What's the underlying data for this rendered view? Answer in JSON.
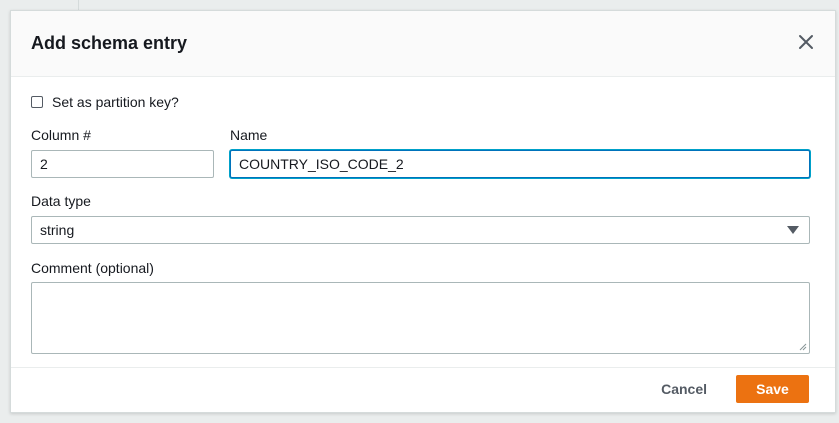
{
  "modal": {
    "title": "Add schema entry"
  },
  "form": {
    "partition_key_label": "Set as partition key?",
    "partition_key_checked": false,
    "column_label": "Column #",
    "column_value": "2",
    "name_label": "Name",
    "name_value": "COUNTRY_ISO_CODE_2",
    "data_type_label": "Data type",
    "data_type_value": "string",
    "comment_label": "Comment (optional)",
    "comment_value": ""
  },
  "footer": {
    "cancel_label": "Cancel",
    "save_label": "Save"
  },
  "colors": {
    "accent": "#ec7211",
    "focus": "#0073bb"
  },
  "icons": {
    "close": "close-icon",
    "dropdown": "caret-down-icon"
  }
}
